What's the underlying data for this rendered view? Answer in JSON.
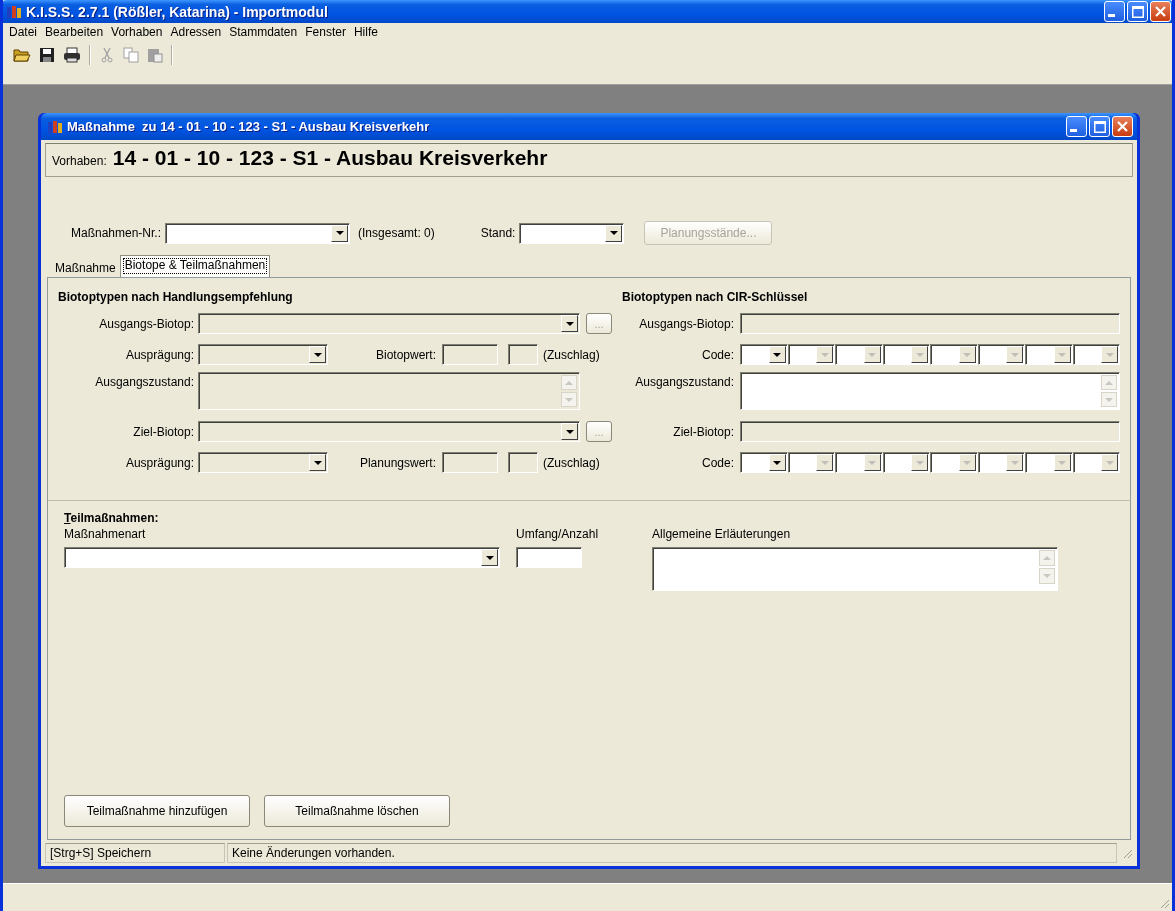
{
  "window": {
    "title": "K.I.S.S. 2.7.1 (Rößler, Katarina) - Importmodul"
  },
  "menu": [
    "Datei",
    "Bearbeiten",
    "Vorhaben",
    "Adressen",
    "Stammdaten",
    "Fenster",
    "Hilfe"
  ],
  "toolbar": [
    {
      "kind": "open",
      "disabled": false
    },
    {
      "kind": "save",
      "disabled": false
    },
    {
      "kind": "print",
      "disabled": false
    },
    {
      "kind": "separator"
    },
    {
      "kind": "cut",
      "disabled": true
    },
    {
      "kind": "copy",
      "disabled": true
    },
    {
      "kind": "paste",
      "disabled": true
    },
    {
      "kind": "separator"
    }
  ],
  "child_window": {
    "title": "Maßnahme  zu 14 - 01 - 10 - 123 - S1 - Ausbau Kreisverkehr",
    "header": {
      "label": "Vorhaben:",
      "value": "14 - 01 - 10 - 123 - S1 - Ausbau Kreisverkehr"
    },
    "selector": {
      "number_label": "Maßnahmen-Nr.:",
      "total": "(Insgesamt: 0)",
      "stand_label": "Stand:",
      "button": {
        "label": "Planungsstände...",
        "disabled": true
      }
    },
    "tabs": [
      {
        "label": "Maßnahme",
        "selected": false
      },
      {
        "label": "Biotope & Teilmaßnahmen",
        "selected": true
      }
    ],
    "left_group": {
      "title": "Biotoptypen nach Handlungsempfehlung",
      "start_biotope": {
        "label": "Ausgangs-Biotop:",
        "disabled": true,
        "browse": "..."
      },
      "start_expression": {
        "label": "Ausprägung:",
        "disabled": true,
        "value_label": "Biotopwert:",
        "surcharge": "(Zuschlag)"
      },
      "start_state": {
        "label": "Ausgangszustand:",
        "disabled": true
      },
      "target_biotope": {
        "label": "Ziel-Biotop:",
        "disabled": true,
        "browse": "..."
      },
      "target_expression": {
        "label": "Ausprägung:",
        "disabled": true,
        "value_label": "Planungswert:",
        "surcharge": "(Zuschlag)"
      }
    },
    "right_group": {
      "title": "Biotoptypen nach CIR-Schlüssel",
      "start_biotope": {
        "label": "Ausgangs-Biotop:",
        "disabled": true
      },
      "start_code": {
        "label": "Code:",
        "combos": [
          {
            "disabled": false
          },
          {
            "disabled": true
          },
          {
            "disabled": true
          },
          {
            "disabled": true
          },
          {
            "disabled": true
          },
          {
            "disabled": true
          },
          {
            "disabled": true
          },
          {
            "disabled": true
          }
        ]
      },
      "start_state": {
        "label": "Ausgangszustand:",
        "disabled": false
      },
      "target_biotope": {
        "label": "Ziel-Biotop:",
        "disabled": true
      },
      "target_code": {
        "label": "Code:",
        "combos": [
          {
            "disabled": false
          },
          {
            "disabled": true
          },
          {
            "disabled": true
          },
          {
            "disabled": true
          },
          {
            "disabled": true
          },
          {
            "disabled": true
          },
          {
            "disabled": true
          },
          {
            "disabled": true
          }
        ]
      }
    },
    "sub_measures": {
      "title": "Teilmaßnahmen:",
      "type_label": "Maßnahmenart",
      "amount_label": "Umfang/Anzahl",
      "notes_label": "Allgemeine Erläuterungen"
    },
    "buttons": [
      "Teilmaßnahme hinzufügen",
      "Teilmaßnahme löschen"
    ],
    "status_bar": [
      "[Strg+S] Speichern",
      "Keine Änderungen vorhanden."
    ]
  }
}
